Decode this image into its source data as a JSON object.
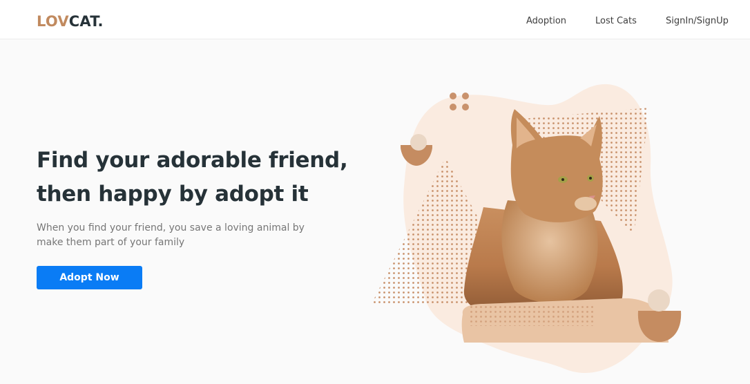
{
  "brand": {
    "part1": "LOV",
    "part2": "CAT."
  },
  "nav": {
    "items": [
      {
        "label": "Adoption"
      },
      {
        "label": "Lost Cats"
      },
      {
        "label": "SignIn/SignUp"
      }
    ]
  },
  "hero": {
    "headline_line1": "Find your adorable friend,",
    "headline_line2": "then happy by adopt it",
    "subtext_line1": "When you find your friend, you save a loving animal by",
    "subtext_line2": "make them part of your family",
    "cta_label": "Adopt Now"
  },
  "colors": {
    "brand_accent": "#c18a5f",
    "brand_dark": "#263238",
    "button": "#0a7cf5",
    "blob": "#faebe0",
    "dots": "#c9926c"
  }
}
